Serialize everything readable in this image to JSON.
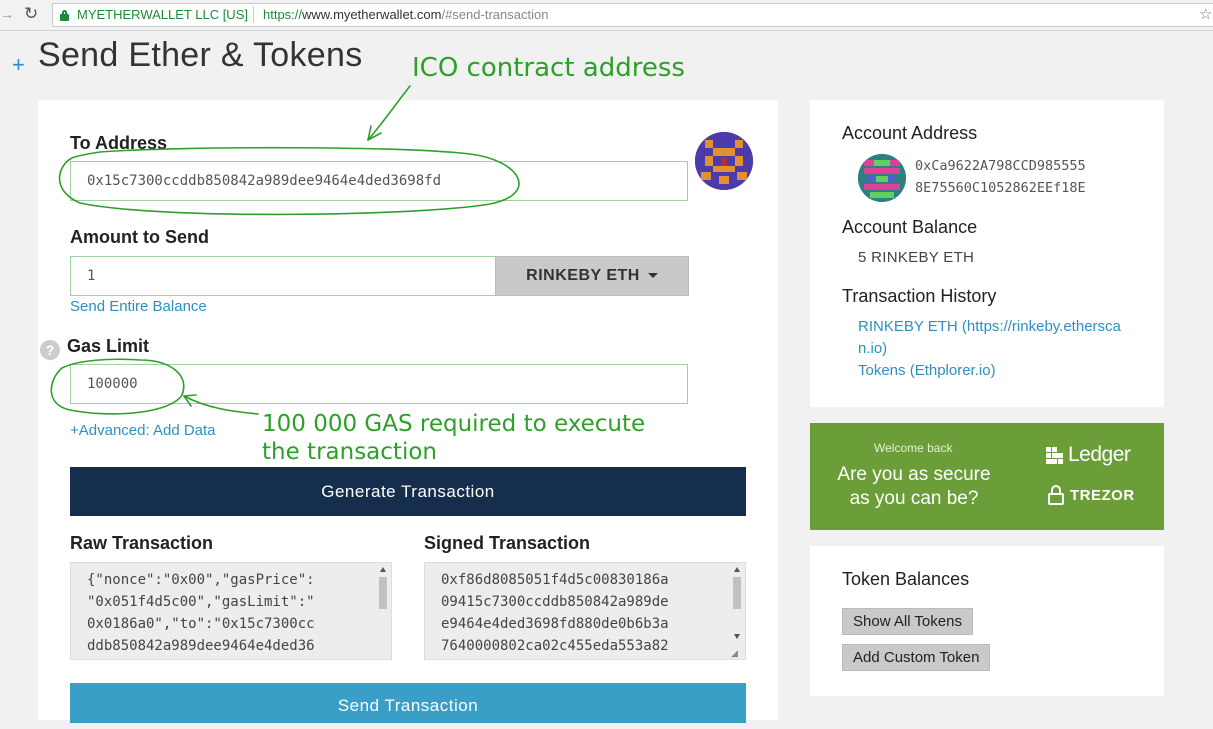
{
  "browser": {
    "ev_name": "MYETHERWALLET LLC [US]",
    "url_proto": "https://",
    "url_host": "www.myetherwallet.com",
    "url_path": "/#send-transaction"
  },
  "page": {
    "plus": "+",
    "title": "Send Ether & Tokens"
  },
  "annotations": {
    "ico": "ICO contract address",
    "gas_line1": "100 000 GAS required to execute",
    "gas_line2": "the transaction",
    "color": "#2ea02a"
  },
  "form": {
    "to_label": "To Address",
    "to_value": "0x15c7300ccddb850842a989dee9464e4ded3698fd",
    "amount_label": "Amount to Send",
    "amount_value": "1",
    "token_label": "RINKEBY ETH",
    "send_entire": "Send Entire Balance",
    "help": "?",
    "gas_label": "Gas Limit",
    "gas_value": "100000",
    "advanced": "+Advanced: Add Data",
    "generate": "Generate Transaction",
    "raw_label": "Raw Transaction",
    "raw_value": "{\"nonce\":\"0x00\",\"gasPrice\":\n\"0x051f4d5c00\",\"gasLimit\":\"\n0x0186a0\",\"to\":\"0x15c7300cc\nddb850842a989dee9464e4ded36",
    "signed_label": "Signed Transaction",
    "signed_value": "0xf86d8085051f4d5c00830186a\n09415c7300ccddb850842a989de\ne9464e4ded3698fd880de0b6b3a\n7640000802ca02c455eda553a82",
    "send": "Send Transaction"
  },
  "sidebar": {
    "address_label": "Account Address",
    "address_line1": "0xCa9622A798CCD985555",
    "address_line2": "8E75560C1052862EEf18E",
    "balance_label": "Account Balance",
    "balance_value": "5 RINKEBY ETH",
    "history_label": "Transaction History",
    "history_link1_a": "RINKEBY ETH (https://rinkeby.ethersca",
    "history_link1_b": "n.io)",
    "history_link2": "Tokens (Ethplorer.io)"
  },
  "promo": {
    "sub": "Welcome back",
    "main": "Are you as secure as you can be?",
    "ledger": "Ledger",
    "trezor": "TREZOR",
    "bg_color": "#6b9e38"
  },
  "tokens": {
    "label": "Token Balances",
    "show_all": "Show All Tokens",
    "add_custom": "Add Custom Token"
  },
  "colors": {
    "accent": "#2f8fbf",
    "generate_bg": "#152e4d",
    "send_bg": "#3a9fc7"
  }
}
